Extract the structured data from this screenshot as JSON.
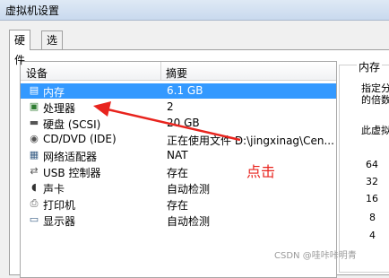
{
  "window": {
    "title": "虚拟机设置"
  },
  "tabs": [
    {
      "label": "硬件",
      "active": true
    },
    {
      "label": "选项",
      "active": false
    }
  ],
  "device_list": {
    "headers": {
      "device": "设备",
      "summary": "摘要"
    },
    "rows": [
      {
        "icon": "memory-icon",
        "device": "内存",
        "summary": "6.1 GB",
        "selected": true
      },
      {
        "icon": "processor-icon",
        "device": "处理器",
        "summary": "2"
      },
      {
        "icon": "hard-disk-icon",
        "device": "硬盘 (SCSI)",
        "summary": "20 GB"
      },
      {
        "icon": "cd-dvd-icon",
        "device": "CD/DVD (IDE)",
        "summary": "正在使用文件 D:\\jingxinag\\Cen..."
      },
      {
        "icon": "network-adapter-icon",
        "device": "网络适配器",
        "summary": "NAT"
      },
      {
        "icon": "usb-icon",
        "device": "USB 控制器",
        "summary": "存在"
      },
      {
        "icon": "sound-card-icon",
        "device": "声卡",
        "summary": "自动检测"
      },
      {
        "icon": "printer-icon",
        "device": "打印机",
        "summary": "存在"
      },
      {
        "icon": "display-icon",
        "device": "显示器",
        "summary": "自动检测"
      }
    ]
  },
  "memory_panel": {
    "title": "内存",
    "desc_line1": "指定分",
    "desc_line2": "的倍数",
    "desc_line3": "此虚拟",
    "scale": [
      "64",
      "32",
      "16",
      "8",
      "4"
    ]
  },
  "annotation": {
    "text": "点击",
    "color": "#e8231d"
  },
  "watermark": "CSDN @哇咔咔明青"
}
